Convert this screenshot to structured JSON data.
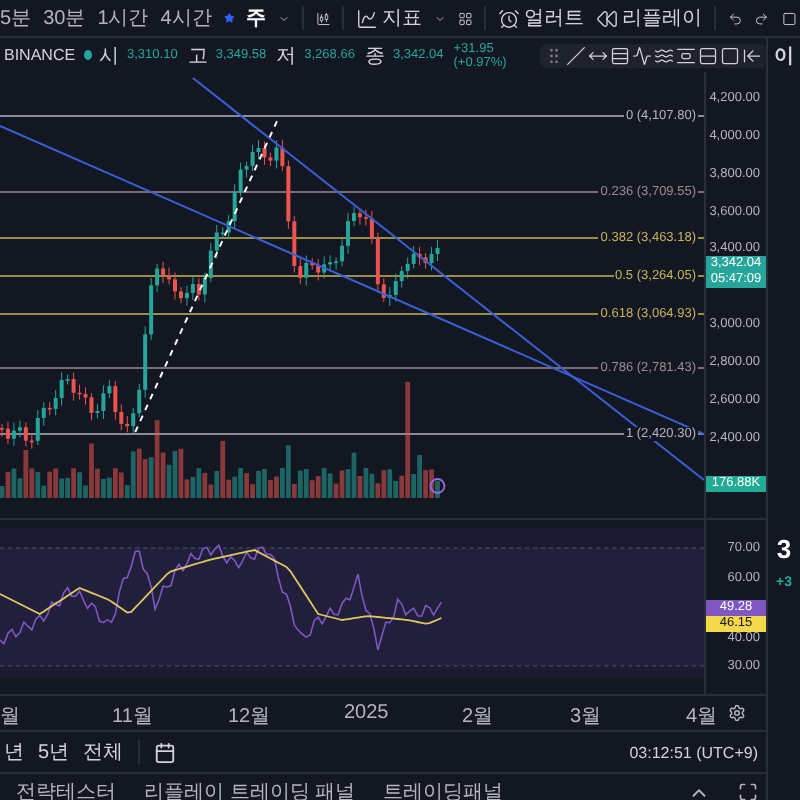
{
  "toolbar": {
    "intervals": [
      {
        "label": "5분",
        "selected": false
      },
      {
        "label": "30분",
        "selected": false
      },
      {
        "label": "1시간",
        "selected": false
      },
      {
        "label": "4시간",
        "selected": false
      },
      {
        "label": "주",
        "selected": true
      }
    ],
    "indicators": "지표",
    "alert": "얼러트",
    "replay": "리플레이"
  },
  "symbol": {
    "exchange": "BINANCE",
    "ohlc": [
      {
        "label": "시",
        "value": "3,310.10"
      },
      {
        "label": "고",
        "value": "3,349.58"
      },
      {
        "label": "저",
        "value": "3,268.66"
      },
      {
        "label": "종",
        "value": "3,342.04"
      }
    ],
    "change": "+31.95 (+0.97%)"
  },
  "fib_levels": [
    {
      "label": "0 (4,107.80)",
      "color": "#b2b5be"
    },
    {
      "label": "0.236 (3,709.55)",
      "color": "#a08a8e"
    },
    {
      "label": "0.382 (3,463.18)",
      "color": "#c9b458"
    },
    {
      "label": "0.5 (3,264.05)",
      "color": "#c9b458"
    },
    {
      "label": "0.618 (3,064.93)",
      "color": "#c9b458"
    },
    {
      "label": "0.786 (2,781.43)",
      "color": "#a08a8e"
    },
    {
      "label": "1 (2,420.30)",
      "color": "#b2b5be"
    }
  ],
  "price_axis": {
    "ticks": [
      "4,200.00",
      "4,000.00",
      "3,800.00",
      "3,600.00",
      "3,400.00",
      "3,000.00",
      "2,800.00",
      "2,600.00",
      "2,400.00"
    ],
    "last_price": "3,342.04",
    "countdown": "05:47:09",
    "volume": "176.88K"
  },
  "rsi": {
    "ticks": [
      "70.00",
      "60.00",
      "40.00",
      "30.00"
    ],
    "rsi_value": "49.28",
    "ma_value": "46.15"
  },
  "time_axis": [
    "월",
    "11월",
    "12월",
    "2025",
    "2월",
    "3월",
    "4월"
  ],
  "range_bar": {
    "ranges": [
      "년",
      "5년",
      "전체"
    ],
    "clock": "03:12:51 (UTC+9)"
  },
  "bottom_tabs": [
    "전략테스터",
    "리플레이 트레이딩 패널",
    "트레이딩패널"
  ],
  "sidebar": {
    "title": "이",
    "price": "3",
    "change": "+3"
  }
}
